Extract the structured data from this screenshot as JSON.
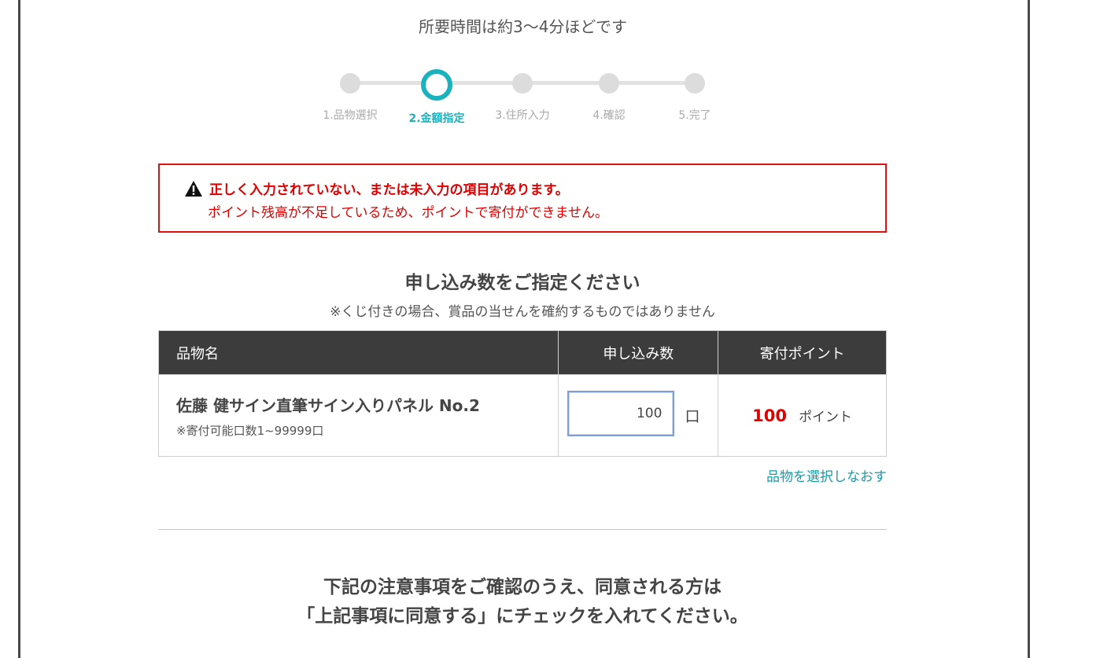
{
  "header": {
    "time_note": "所要時間は約3～4分ほどです"
  },
  "stepper": {
    "steps": [
      {
        "label": "1.品物選択"
      },
      {
        "label": "2.金額指定"
      },
      {
        "label": "3.住所入力"
      },
      {
        "label": "4.確認"
      },
      {
        "label": "5.完了"
      }
    ],
    "active_index": 1
  },
  "error": {
    "title": "正しく入力されていない、または未入力の項目があります。",
    "message": "ポイント残高が不足しているため、ポイントで寄付ができません。"
  },
  "order": {
    "title": "申し込み数をご指定ください",
    "note": "※くじ付きの場合、賞品の当せんを確約するものではありません",
    "columns": {
      "item": "品物名",
      "quantity": "申し込み数",
      "points": "寄付ポイント"
    },
    "rows": [
      {
        "name": "佐藤 健サイン直筆サイン入りパネル No.2",
        "limit": "※寄付可能口数1~99999口",
        "quantity": "100",
        "quantity_unit": "口",
        "points": "100",
        "points_unit": "ポイント"
      }
    ],
    "reselect_link": "品物を選択しなおす"
  },
  "agreement": {
    "line1": "下記の注意事項をご確認のうえ、同意される方は",
    "line2": "「上記事項に同意する」にチェックを入れてください。"
  },
  "colors": {
    "accent": "#19b2bd",
    "error": "#e00000",
    "header_bg": "#3c3c3c"
  },
  "icons": {
    "warning": "warning-icon"
  }
}
